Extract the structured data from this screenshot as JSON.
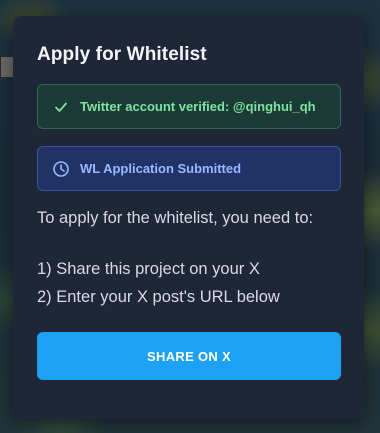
{
  "dialog": {
    "title": "Apply for Whitelist",
    "verified_banner": {
      "text": "Twitter account verified: @qinghui_qh",
      "icon": "check-icon",
      "color": "#7ee2a0"
    },
    "submitted_banner": {
      "text": "WL Application Submitted",
      "icon": "clock-icon",
      "color": "#9ab8ff"
    },
    "instructions": {
      "intro": "To apply for the whitelist, you need to:",
      "steps": [
        "1) Share this project on your X",
        "2) Enter your X post's URL below"
      ]
    },
    "share_button": {
      "label": "SHARE ON X",
      "color": "#1da1f2"
    }
  }
}
